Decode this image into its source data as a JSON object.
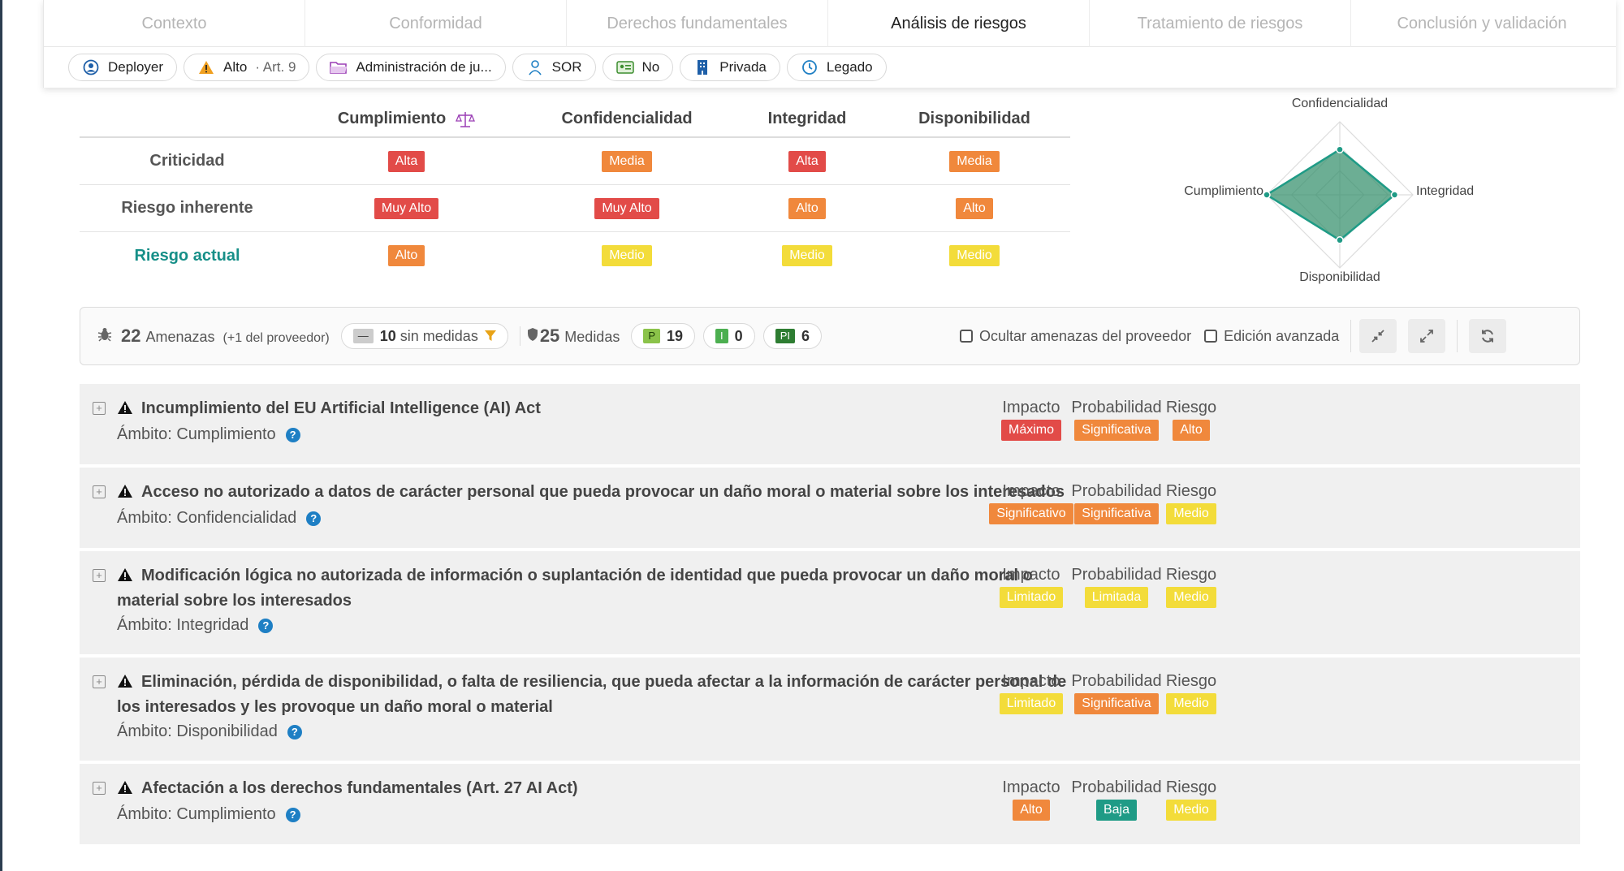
{
  "tabs": [
    "Contexto",
    "Conformidad",
    "Derechos fundamentales",
    "Análisis de riesgos",
    "Tratamiento de riesgos",
    "Conclusión y validación"
  ],
  "active_tab": "Análisis de riesgos",
  "chips": [
    {
      "icon": "user-circle-icon",
      "label": "Deployer",
      "muted": ""
    },
    {
      "icon": "warning-icon",
      "label": "Alto",
      "muted": "· Art. 9"
    },
    {
      "icon": "folder-icon",
      "label": "Administración de ju...",
      "muted": ""
    },
    {
      "icon": "person-icon",
      "label": "SOR",
      "muted": ""
    },
    {
      "icon": "id-card-icon",
      "label": "No",
      "muted": ""
    },
    {
      "icon": "building-icon",
      "label": "Privada",
      "muted": ""
    },
    {
      "icon": "clock-icon",
      "label": "Legado",
      "muted": ""
    }
  ],
  "matrix": {
    "columns": [
      "Cumplimiento",
      "Confidencialidad",
      "Integridad",
      "Disponibilidad"
    ],
    "rows": [
      {
        "label": "Criticidad",
        "values": [
          {
            "text": "Alta",
            "color": "#e24b48"
          },
          {
            "text": "Media",
            "color": "#f0883c"
          },
          {
            "text": "Alta",
            "color": "#e24b48"
          },
          {
            "text": "Media",
            "color": "#f0883c"
          }
        ]
      },
      {
        "label": "Riesgo inherente",
        "values": [
          {
            "text": "Muy Alto",
            "color": "#e24b48"
          },
          {
            "text": "Muy Alto",
            "color": "#e24b48"
          },
          {
            "text": "Alto",
            "color": "#f0883c"
          },
          {
            "text": "Alto",
            "color": "#f0883c"
          }
        ]
      },
      {
        "label": "Riesgo actual",
        "values": [
          {
            "text": "Alto",
            "color": "#f0883c"
          },
          {
            "text": "Medio",
            "color": "#f3dc3a"
          },
          {
            "text": "Medio",
            "color": "#f3dc3a"
          },
          {
            "text": "Medio",
            "color": "#f3dc3a"
          }
        ]
      }
    ]
  },
  "radar": {
    "labels": {
      "top": "Confidencialidad",
      "right": "Integridad",
      "bottom": "Disponibilidad",
      "left": "Cumplimiento"
    },
    "values": {
      "top": 0.62,
      "right": 0.75,
      "bottom": 0.62,
      "left": 1.0
    },
    "fill": "#2e8b66"
  },
  "toolbar": {
    "threats_count": "22",
    "threats_label": "Amenazas",
    "threats_extra": "(+1 del proveedor)",
    "no_measures_badge": "—",
    "no_measures_count": "10",
    "no_measures_label": "sin medidas",
    "measures_count": "25",
    "measures_label": "Medidas",
    "p_badge": "P",
    "p_count": "19",
    "i_badge": "I",
    "i_count": "0",
    "pi_badge": "PI",
    "pi_count": "6",
    "hide_vendor": "Ocultar amenazas del proveedor",
    "advanced_edit": "Edición avanzada"
  },
  "metric_labels": {
    "impact": "Impacto",
    "probability": "Probabilidad",
    "risk": "Riesgo"
  },
  "threats": [
    {
      "title": "Incumplimiento del EU Artificial Intelligence (AI) Act",
      "scope": "Ámbito: Cumplimiento",
      "impact": {
        "text": "Máximo",
        "color": "#e24b48"
      },
      "probability": {
        "text": "Significativa",
        "color": "#f0883c"
      },
      "risk": {
        "text": "Alto",
        "color": "#f0883c"
      }
    },
    {
      "title": "Acceso no autorizado a datos de carácter personal que pueda provocar un daño moral o material sobre los interesados",
      "scope": "Ámbito: Confidencialidad",
      "impact": {
        "text": "Significativo",
        "color": "#f0883c"
      },
      "probability": {
        "text": "Significativa",
        "color": "#f0883c"
      },
      "risk": {
        "text": "Medio",
        "color": "#f3dc3a"
      }
    },
    {
      "title": "Modificación lógica no autorizada de información o suplantación de identidad que pueda provocar un daño moral o material sobre los interesados",
      "scope": "Ámbito: Integridad",
      "impact": {
        "text": "Limitado",
        "color": "#f3dc3a"
      },
      "probability": {
        "text": "Limitada",
        "color": "#f3dc3a"
      },
      "risk": {
        "text": "Medio",
        "color": "#f3dc3a"
      }
    },
    {
      "title": "Eliminación, pérdida de disponibilidad, o falta de resiliencia, que pueda afectar a la información de carácter personal de los interesados y les provoque un daño moral o material",
      "scope": "Ámbito: Disponibilidad",
      "impact": {
        "text": "Limitado",
        "color": "#f3dc3a"
      },
      "probability": {
        "text": "Significativa",
        "color": "#f0883c"
      },
      "risk": {
        "text": "Medio",
        "color": "#f3dc3a"
      }
    },
    {
      "title": "Afectación a los derechos fundamentales (Art. 27 AI Act)",
      "scope": "Ámbito: Cumplimiento",
      "impact": {
        "text": "Alto",
        "color": "#f0883c"
      },
      "probability": {
        "text": "Baja",
        "color": "#1f9b86"
      },
      "risk": {
        "text": "Medio",
        "color": "#f3dc3a"
      }
    }
  ]
}
